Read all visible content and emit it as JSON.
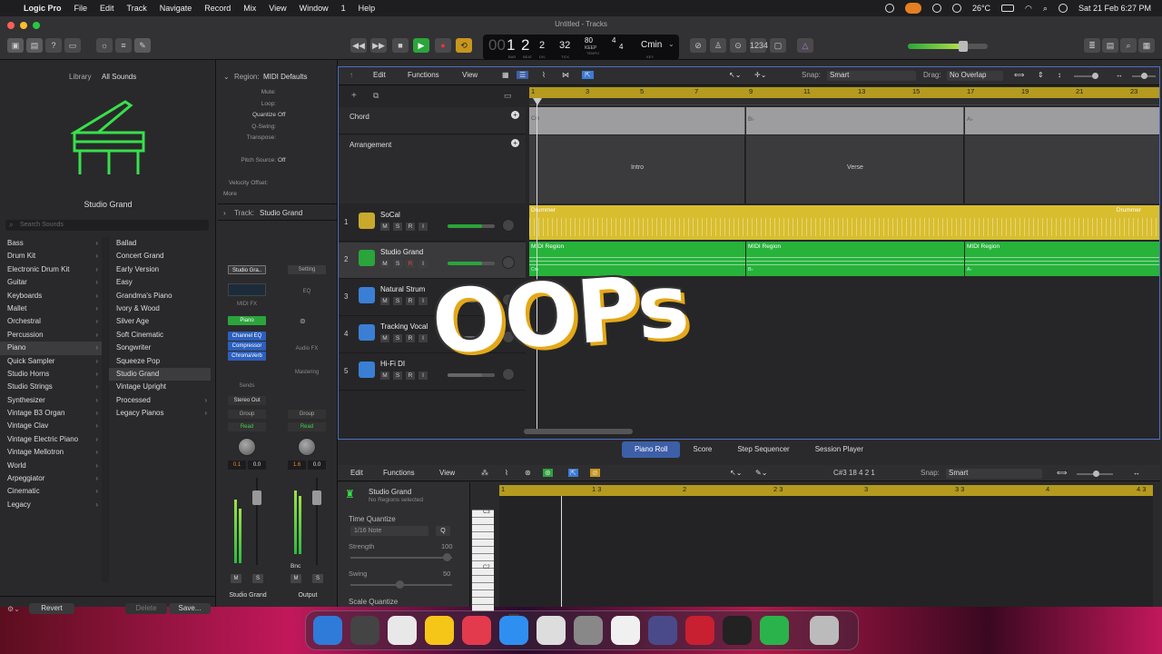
{
  "menubar": {
    "app": "Logic Pro",
    "items": [
      "File",
      "Edit",
      "Track",
      "Navigate",
      "Record",
      "Mix",
      "View",
      "Window",
      "1",
      "Help"
    ],
    "weather": "26°C",
    "datetime": "Sat 21 Feb  6:27 PM"
  },
  "window": {
    "title": "Untitled - Tracks"
  },
  "transport": {
    "bar": "1",
    "beat": "2",
    "div": "2",
    "tick": "32",
    "tempo": "80",
    "tempo_mode": "KEEP",
    "timesig_top": "4",
    "timesig_bottom": "4",
    "key": "Cmin",
    "labels": [
      "BAR",
      "BEAT",
      "DIV",
      "TICK",
      "TEMPO",
      "KEY"
    ]
  },
  "library": {
    "title": "Library",
    "filter": "All Sounds",
    "instrument": "Studio Grand",
    "search_placeholder": "Search Sounds",
    "categories": [
      "Bass",
      "Drum Kit",
      "Electronic Drum Kit",
      "Guitar",
      "Keyboards",
      "Mallet",
      "Orchestral",
      "Percussion",
      "Piano",
      "Quick Sampler",
      "Studio Horns",
      "Studio Strings",
      "Synthesizer",
      "Vintage B3 Organ",
      "Vintage Clav",
      "Vintage Electric Piano",
      "Vintage Mellotron",
      "World",
      "Arpeggiator",
      "Cinematic",
      "Legacy"
    ],
    "selected_category": "Piano",
    "sounds": [
      "Ballad",
      "Concert Grand",
      "Early Version",
      "Easy",
      "Grandma's Piano",
      "Ivory & Wood",
      "Silver Age",
      "Soft Cinematic",
      "Songwriter",
      "Squeeze Pop",
      "Studio Grand",
      "Vintage Upright",
      "Processed",
      "Legacy Pianos"
    ],
    "selected_sound": "Studio Grand",
    "revert": "Revert",
    "delete": "Delete",
    "save": "Save..."
  },
  "inspector": {
    "region_label": "Region:",
    "region_name": "MIDI Defaults",
    "mute": "Mute:",
    "loop": "Loop:",
    "quantize": "Quantize",
    "quantize_val": "Off",
    "qswing": "Q-Swing:",
    "transpose": "Transpose:",
    "pitch_source": "Pitch Source:",
    "pitch_source_val": "Off",
    "velocity_offset": "Velocity Offset:",
    "more": "More",
    "track_label": "Track:",
    "track_name": "Studio Grand",
    "strip1": {
      "name_field": "Studio Gra..",
      "midi_fx": "MIDI FX",
      "instrument": "Piano",
      "plugins": [
        "Channel EQ",
        "Compressor",
        "ChromaVerb"
      ],
      "sends": "Sends",
      "output": "Stereo Out",
      "group": "Group",
      "read": "Read",
      "val1": "0.1",
      "val2": "0.0",
      "m": "M",
      "s": "S",
      "name": "Studio Grand"
    },
    "strip2": {
      "setting": "Setting",
      "eq": "EQ",
      "audio_fx": "Audio FX",
      "mastering": "Mastering",
      "group": "Group",
      "read": "Read",
      "val1": "1.6",
      "val2": "0.0",
      "bnc": "Bnc",
      "m": "M",
      "s": "S",
      "name": "Output"
    }
  },
  "tracks_toolbar": {
    "edit": "Edit",
    "functions": "Functions",
    "view": "View",
    "snap_label": "Snap:",
    "snap": "Smart",
    "drag_label": "Drag:",
    "drag": "No Overlap"
  },
  "ruler": [
    "1",
    "3",
    "5",
    "7",
    "9",
    "11",
    "13",
    "15",
    "17",
    "19",
    "21",
    "23"
  ],
  "global_tracks": {
    "chord": "Chord",
    "arrangement": "Arrangement",
    "chords": [
      "Cm",
      "B♭",
      "A♭"
    ],
    "sections": [
      "Intro",
      "Verse"
    ]
  },
  "tracks": [
    {
      "num": "1",
      "name": "SoCal",
      "color": "#c9a92c"
    },
    {
      "num": "2",
      "name": "Studio Grand",
      "color": "#2ba43b"
    },
    {
      "num": "3",
      "name": "Natural Strum",
      "color": "#3b7fd4"
    },
    {
      "num": "4",
      "name": "Tracking Vocal",
      "color": "#3b7fd4"
    },
    {
      "num": "5",
      "name": "Hi-Fi DI",
      "color": "#3b7fd4"
    }
  ],
  "msri": [
    "M",
    "S",
    "R",
    "I"
  ],
  "regions": {
    "drummer": "Drummer",
    "midi": "MIDI Region",
    "midi_chords": [
      "Cm",
      "B♭",
      "A♭"
    ]
  },
  "editor": {
    "tabs": [
      "Piano Roll",
      "Score",
      "Step Sequencer",
      "Session Player"
    ],
    "selected_tab": "Piano Roll",
    "edit": "Edit",
    "functions": "Functions",
    "view": "View",
    "position": "C#3   18 4 2 1",
    "snap_label": "Snap:",
    "snap": "Smart",
    "track_name": "Studio Grand",
    "track_sub": "No Regions selected",
    "time_quantize": "Time Quantize",
    "quant_value": "1/16 Note",
    "q": "Q",
    "strength": "Strength",
    "strength_val": "100",
    "swing": "Swing",
    "swing_val": "50",
    "scale_quantize": "Scale Quantize",
    "ruler": [
      "1",
      "1 3",
      "2",
      "2 3",
      "3",
      "3 3",
      "4",
      "4 3"
    ],
    "keys": [
      "C3",
      "C2"
    ]
  },
  "overlay": {
    "text": "OOPs"
  },
  "dock": {
    "apps": [
      "finder-icon",
      "launchpad-icon",
      "chrome-icon",
      "notes-icon",
      "music-icon",
      "appstore-icon",
      "preview-icon",
      "settings-icon",
      "photos-icon",
      "davinci-icon",
      "wps-icon",
      "logic-icon",
      "facetime-icon",
      "trash-icon"
    ]
  }
}
